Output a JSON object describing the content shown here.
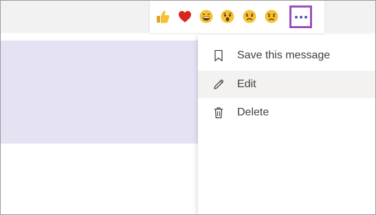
{
  "reactions": [
    {
      "name": "like",
      "icon": "thumbs-up-icon"
    },
    {
      "name": "heart",
      "icon": "heart-icon"
    },
    {
      "name": "laugh",
      "icon": "laughing-face-icon"
    },
    {
      "name": "surprised",
      "icon": "surprised-face-icon"
    },
    {
      "name": "sad",
      "icon": "sad-face-icon"
    },
    {
      "name": "angry",
      "icon": "angry-face-icon"
    }
  ],
  "more_options": {
    "icon": "more-options-icon"
  },
  "menu": {
    "items": [
      {
        "label": "Save this message",
        "icon": "bookmark-icon"
      },
      {
        "label": "Edit",
        "icon": "pencil-icon"
      },
      {
        "label": "Delete",
        "icon": "trash-icon"
      }
    ]
  },
  "colors": {
    "accent_highlight": "#9b4dbb",
    "message_bubble": "#e5e3f3",
    "emoji_yellow": "#f6c234",
    "heart_red": "#d9251c",
    "more_dots": "#4f52b2"
  }
}
